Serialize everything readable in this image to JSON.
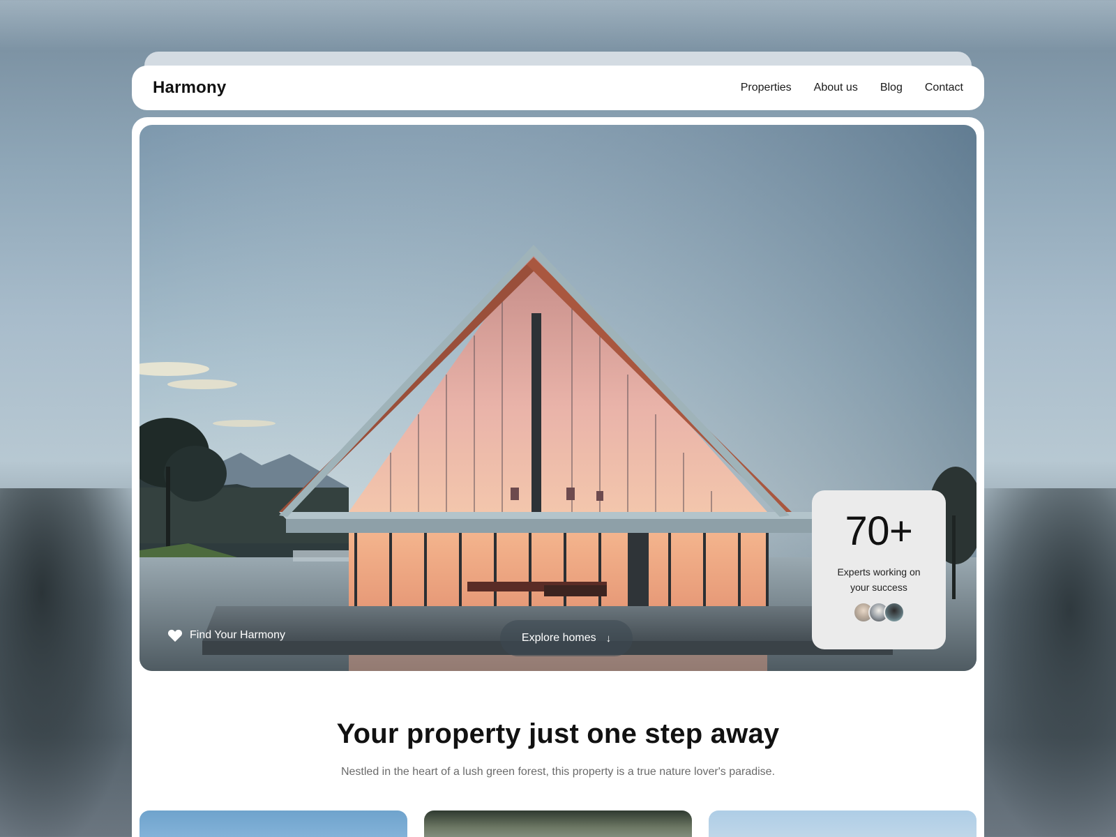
{
  "brand": {
    "name": "Harmony"
  },
  "nav": {
    "items": [
      {
        "label": "Properties"
      },
      {
        "label": "About us"
      },
      {
        "label": "Blog"
      },
      {
        "label": "Contact"
      }
    ]
  },
  "hero": {
    "tagline": "Find Your Harmony",
    "tagline_icon": "heart-icon",
    "cta_label": "Explore homes",
    "cta_icon": "arrow-down-icon",
    "stat": {
      "value": "70+",
      "caption": "Experts working on your success",
      "avatar_count": 3
    }
  },
  "section": {
    "title": "Your property just one step away",
    "subtitle": "Nestled in the heart of a lush green forest, this property is a true nature lover's paradise."
  },
  "colors": {
    "surface": "#ffffff",
    "stat_card": "#ebebeb",
    "text_primary": "#111111",
    "text_muted": "#6a6a6a",
    "cta_background": "#3c4852"
  }
}
